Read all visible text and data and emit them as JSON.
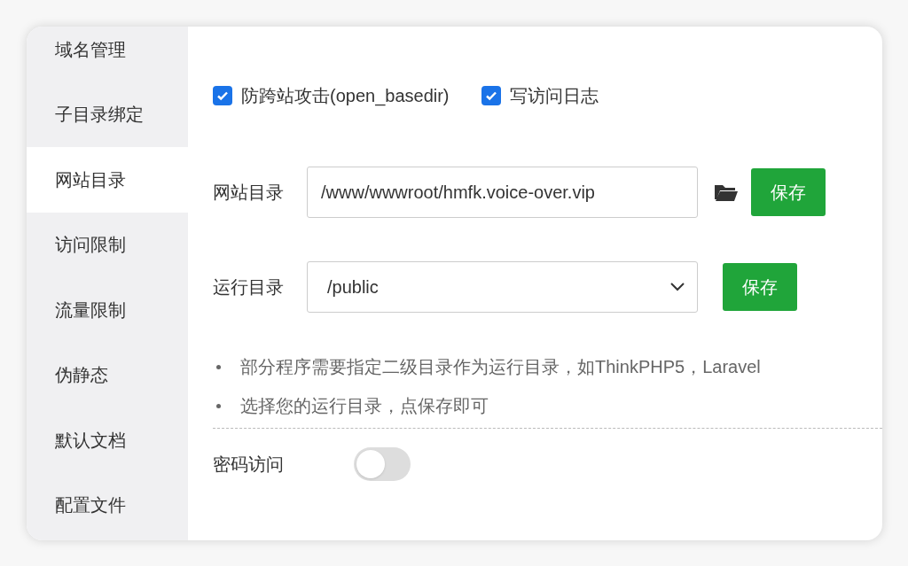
{
  "sidebar": {
    "items": [
      {
        "label": "域名管理",
        "selected": false
      },
      {
        "label": "子目录绑定",
        "selected": false
      },
      {
        "label": "网站目录",
        "selected": true
      },
      {
        "label": "访问限制",
        "selected": false
      },
      {
        "label": "流量限制",
        "selected": false
      },
      {
        "label": "伪静态",
        "selected": false
      },
      {
        "label": "默认文档",
        "selected": false
      },
      {
        "label": "配置文件",
        "selected": false
      }
    ]
  },
  "options": [
    {
      "label": "防跨站攻击(open_basedir)",
      "checked": true
    },
    {
      "label": "写访问日志",
      "checked": true
    }
  ],
  "site_dir": {
    "label": "网站目录",
    "value": "/www/wwwroot/hmfk.voice-over.vip",
    "button": "保存"
  },
  "run_dir": {
    "label": "运行目录",
    "value": "/public",
    "button": "保存"
  },
  "notes": [
    "部分程序需要指定二级目录作为运行目录，如ThinkPHP5，Laravel",
    "选择您的运行目录，点保存即可"
  ],
  "password_access": {
    "label": "密码访问",
    "on": false
  }
}
